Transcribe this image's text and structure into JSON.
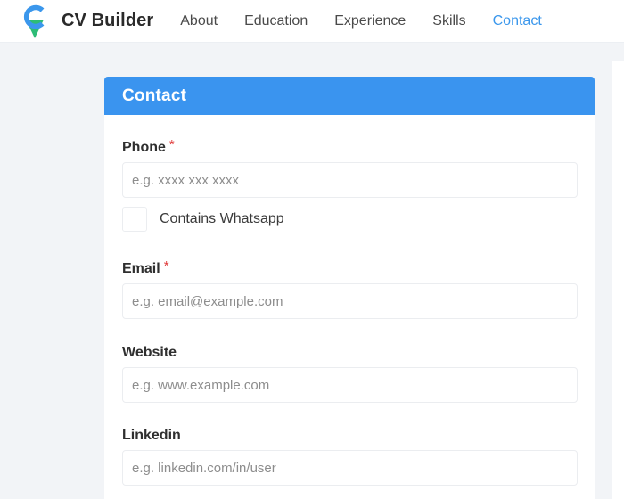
{
  "brand": {
    "name": "CV Builder",
    "logo_icon": "map-pin-logo-icon",
    "colors": {
      "primary": "#3b97ec",
      "secondary": "#2ebc76"
    }
  },
  "nav": {
    "items": [
      {
        "label": "About",
        "active": false
      },
      {
        "label": "Education",
        "active": false
      },
      {
        "label": "Experience",
        "active": false
      },
      {
        "label": "Skills",
        "active": false
      },
      {
        "label": "Contact",
        "active": true
      }
    ]
  },
  "card": {
    "title": "Contact",
    "header_color": "#3a94ef"
  },
  "form": {
    "phone": {
      "label": "Phone",
      "required_mark": "*",
      "value": "",
      "placeholder": "e.g. xxxx xxx xxxx"
    },
    "whatsapp": {
      "label": "Contains Whatsapp",
      "checked": false
    },
    "email": {
      "label": "Email",
      "required_mark": "*",
      "value": "",
      "placeholder": "e.g. email@example.com"
    },
    "website": {
      "label": "Website",
      "value": "",
      "placeholder": "e.g. www.example.com"
    },
    "linkedin": {
      "label": "Linkedin",
      "value": "",
      "placeholder": "e.g. linkedin.com/in/user"
    }
  }
}
